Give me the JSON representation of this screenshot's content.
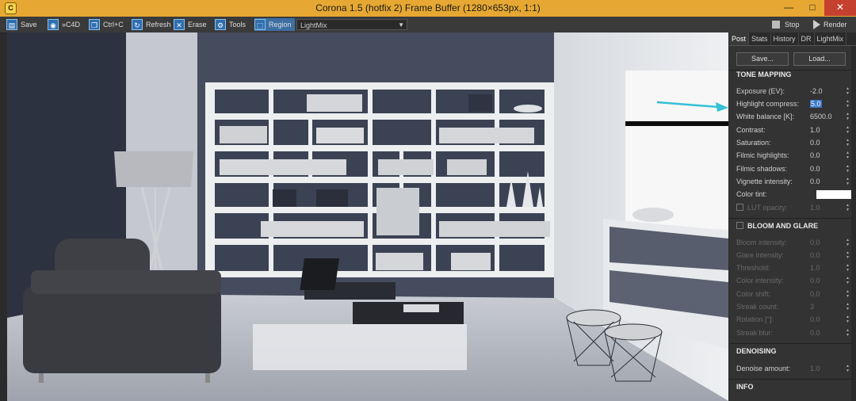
{
  "window": {
    "title": "Corona 1.5 (hotfix 2) Frame Buffer (1280×653px, 1:1)",
    "app_icon": "C",
    "minimize": "—",
    "maximize": "□",
    "close": "✕"
  },
  "toolbar": {
    "save": "Save",
    "to_c4d": "»C4D",
    "copy": "Ctrl+C",
    "refresh": "Refresh",
    "erase": "Erase",
    "tools": "Tools",
    "region": "Region",
    "select_value": "LightMix",
    "stop": "Stop",
    "render": "Render"
  },
  "panel": {
    "tabs": [
      "Post",
      "Stats",
      "History",
      "DR",
      "LightMix"
    ],
    "save_btn": "Save...",
    "load_btn": "Load...",
    "sections": {
      "tone": "TONE MAPPING",
      "bloom": "BLOOM AND GLARE",
      "denoise": "DENOISING",
      "info": "INFO"
    },
    "tone_rows": [
      {
        "label": "Exposure (EV):",
        "value": "-2.0"
      },
      {
        "label": "Highlight compress:",
        "value": "5.0"
      },
      {
        "label": "White balance [K]:",
        "value": "6500.0"
      },
      {
        "label": "Contrast:",
        "value": "1.0"
      },
      {
        "label": "Saturation:",
        "value": "0.0"
      },
      {
        "label": "Filmic highlights:",
        "value": "0.0"
      },
      {
        "label": "Filmic shadows:",
        "value": "0.0"
      },
      {
        "label": "Vignette intensity:",
        "value": "0.0"
      },
      {
        "label": "Color tint:",
        "value": ""
      },
      {
        "label": "LUT opacity:",
        "value": "1.0"
      }
    ],
    "bloom_rows": [
      {
        "label": "Bloom intensity:",
        "value": "0.0"
      },
      {
        "label": "Glare intensity:",
        "value": "0.0"
      },
      {
        "label": "Threshold:",
        "value": "1.0"
      },
      {
        "label": "Color intensity:",
        "value": "0.0"
      },
      {
        "label": "Color shift:",
        "value": "0.0"
      },
      {
        "label": "Streak count:",
        "value": "3"
      },
      {
        "label": "Rotation [°]:",
        "value": "0.0"
      },
      {
        "label": "Streak blur:",
        "value": "0.0"
      }
    ],
    "denoise_rows": [
      {
        "label": "Denoise amount:",
        "value": "1.0"
      }
    ]
  },
  "colors": {
    "title_bar": "#e6a832",
    "accent": "#3d78c8",
    "annotation_arrow": "#33c2d6"
  }
}
